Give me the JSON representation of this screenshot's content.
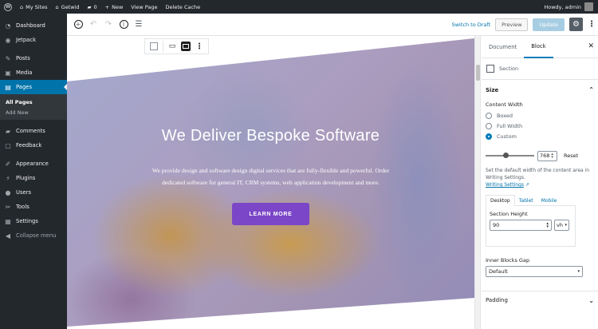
{
  "adminbar": {
    "wp_logo": "W",
    "my_sites": "My Sites",
    "site_name": "Getwid",
    "comments_count": "0",
    "new_label": "New",
    "view_page": "View Page",
    "delete_cache": "Delete Cache",
    "howdy": "Howdy, admin"
  },
  "sidebar": {
    "items": [
      {
        "label": "Dashboard",
        "icon": "dashboard-icon"
      },
      {
        "label": "Jetpack",
        "icon": "jetpack-icon"
      },
      {
        "label": "Posts",
        "icon": "pin-icon"
      },
      {
        "label": "Media",
        "icon": "media-icon"
      },
      {
        "label": "Pages",
        "icon": "pages-icon",
        "active": true
      },
      {
        "label": "Comments",
        "icon": "comments-icon"
      },
      {
        "label": "Feedback",
        "icon": "feedback-icon"
      },
      {
        "label": "Appearance",
        "icon": "brush-icon"
      },
      {
        "label": "Plugins",
        "icon": "plugin-icon"
      },
      {
        "label": "Users",
        "icon": "users-icon"
      },
      {
        "label": "Tools",
        "icon": "wrench-icon"
      },
      {
        "label": "Settings",
        "icon": "settings-icon"
      },
      {
        "label": "Collapse menu",
        "icon": "collapse-icon"
      }
    ],
    "submenu": [
      "All Pages",
      "Add New"
    ]
  },
  "editor": {
    "switch_to_draft": "Switch to Draft",
    "preview": "Preview",
    "update": "Update"
  },
  "hero": {
    "title": "We Deliver Bespoke Software",
    "text_line1": "We provide design and  software design digital services that are fully-flexible and powerful. Order",
    "text_line2": "dedicated software for general IT, CRM systems, web application  development and more.",
    "button": "LEARN MORE"
  },
  "panel": {
    "tabs": [
      "Document",
      "Block"
    ],
    "active_tab": "Block",
    "block_name": "Section",
    "size_heading": "Size",
    "content_width_label": "Content Width",
    "width_options": [
      "Boxed",
      "Full Width",
      "Custom"
    ],
    "selected_width": "Custom",
    "custom_width_value": "768",
    "reset": "Reset",
    "help_text": "Set the default width of the content area in Writing Settings.",
    "help_link": "Writing Settings",
    "device_tabs": [
      "Desktop",
      "Tablet",
      "Mobile"
    ],
    "active_device": "Desktop",
    "section_height_label": "Section Height",
    "section_height_value": "90",
    "section_height_unit": "vh",
    "inner_gap_label": "Inner Blocks Gap",
    "inner_gap_value": "Default",
    "padding_heading": "Padding"
  },
  "colors": {
    "admin_dark": "#23282d",
    "admin_blue": "#0073aa",
    "hero_button": "#7b46c7"
  }
}
